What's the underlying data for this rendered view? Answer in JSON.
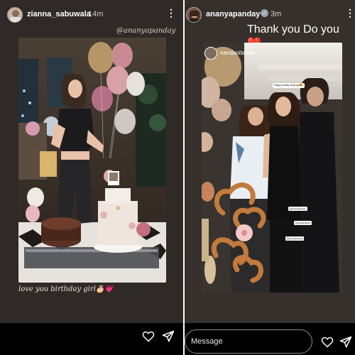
{
  "left_story": {
    "username": "zianna_sabuwala",
    "time": "14m",
    "mention": "@ananyapanday",
    "caption": "love you birthday girl🎂💗",
    "icons": {
      "more": "more-vertical-icon",
      "like": "heart-icon",
      "share": "send-icon"
    }
  },
  "right_story": {
    "username": "ananyapanday",
    "time": "3m",
    "title": "Thank you Do you ❤️",
    "reshared_from": "nandanitasha",
    "photo_sticker": "Happy bday Ananya😍",
    "photo_tags": [
      "@ananyapanday",
      "@nandanitasha",
      "@chunkypanday"
    ],
    "message_placeholder": "Message",
    "icons": {
      "verified": "verified-badge-icon",
      "more": "more-vertical-icon",
      "like": "heart-icon",
      "share": "send-icon"
    }
  },
  "colors": {
    "left_background": "#2f2927",
    "right_background": "#35302c",
    "heart_accent": "#e2334d"
  }
}
